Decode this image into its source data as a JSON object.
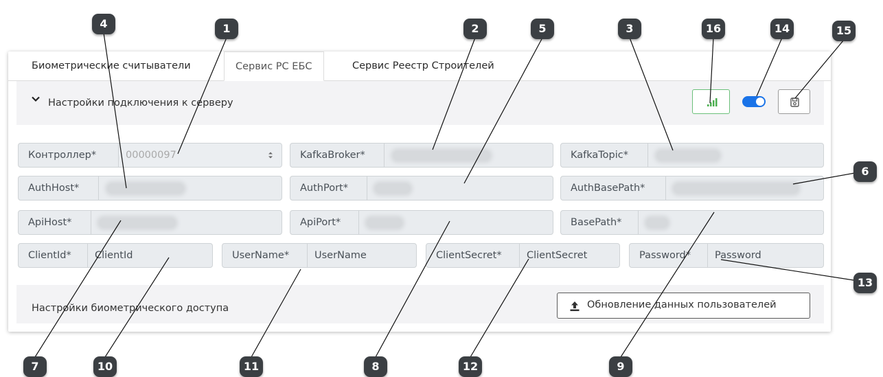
{
  "tabs": [
    {
      "label": "Биометрические считыватели"
    },
    {
      "label": "Сервис РС ЕБС"
    },
    {
      "label": "Сервис Реестр Строителей"
    }
  ],
  "server_settings": {
    "title": "Настройки подключения к серверу"
  },
  "fields": {
    "controller": {
      "label": "Контроллер*",
      "value": "00000097"
    },
    "kafka_broker": {
      "label": "KafkaBroker*"
    },
    "kafka_topic": {
      "label": "KafkaTopic*"
    },
    "auth_host": {
      "label": "AuthHost*"
    },
    "auth_port": {
      "label": "AuthPort*"
    },
    "auth_base_path": {
      "label": "AuthBasePath*"
    },
    "api_host": {
      "label": "ApiHost*"
    },
    "api_port": {
      "label": "ApiPort*"
    },
    "base_path": {
      "label": "BasePath*"
    },
    "client_id": {
      "label": "ClientId*",
      "value": "ClientId"
    },
    "user_name": {
      "label": "UserName*",
      "value": "UserName"
    },
    "client_secret": {
      "label": "ClientSecret*",
      "value": "ClientSecret"
    },
    "password": {
      "label": "Password*",
      "value": "Password"
    }
  },
  "biometric": {
    "title": "Настройки биометрического доступа",
    "update_button": "Обновление данных пользователей"
  },
  "icons": {
    "collapse": "chevron-down-icon",
    "connection": "signal-bars-icon",
    "save": "floppy-disk-icon",
    "update": "upload-icon"
  },
  "colors": {
    "accent": "#1a73e8",
    "success": "#4caf50",
    "badge": "#3b3f43"
  },
  "callouts": [
    "1",
    "2",
    "3",
    "4",
    "5",
    "6",
    "7",
    "8",
    "9",
    "10",
    "11",
    "12",
    "13",
    "14",
    "15",
    "16"
  ]
}
